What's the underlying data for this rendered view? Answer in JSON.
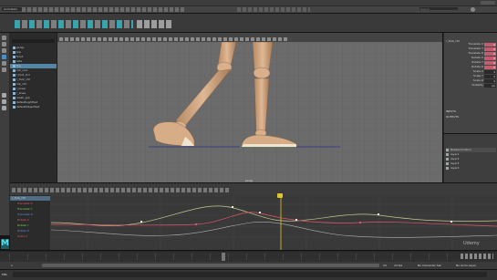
{
  "app": {
    "title": "Autodesk Maya",
    "logo_letter": "M",
    "accent": "#35b8c6",
    "viewport_bg": "#6b6b6b",
    "panel_bg": "#444444"
  },
  "menubar": {
    "items": [
      "File",
      "Edit",
      "Create",
      "Select",
      "Modify",
      "Display",
      "Windows",
      "Key",
      "Playback",
      "Audio",
      "Visualize",
      "Deform",
      "Constrain",
      "Control",
      "Cache",
      "Arnold",
      "Help"
    ]
  },
  "status_line": {
    "workspace": "Animation",
    "search_placeholder": "Search..."
  },
  "shelf": {
    "tabs": [
      "Curves / Surfaces",
      "Poly Modeling",
      "Sculpting",
      "Rigging",
      "Animation",
      "Rendering",
      "FX",
      "FX Caching",
      "Custom",
      "XGen"
    ]
  },
  "viewport": {
    "menu": [
      "View",
      "Shading",
      "Lighting",
      "Show",
      "Renderer",
      "Panels"
    ],
    "camera_label": "persp",
    "character": "wooden mannequin legs"
  },
  "outliner": {
    "menu": [
      "Display",
      "Show",
      "Help"
    ],
    "items": [
      {
        "name": "persp",
        "selected": false
      },
      {
        "name": "top",
        "selected": false
      },
      {
        "name": "front",
        "selected": false
      },
      {
        "name": "side",
        "selected": false
      },
      {
        "name": "Rig",
        "selected": true
      },
      {
        "name": "ctrl_root",
        "selected": false
      },
      {
        "name": "l_foot_ctrl",
        "selected": false
      },
      {
        "name": "r_foot_ctrl",
        "selected": false
      },
      {
        "name": "hip_ctrl",
        "selected": false
      },
      {
        "name": "l_knee",
        "selected": false
      },
      {
        "name": "r_knee",
        "selected": false
      },
      {
        "name": "mesh_grp",
        "selected": false
      },
      {
        "name": "defaultLightSet",
        "selected": false
      },
      {
        "name": "defaultObjectSet",
        "selected": false
      }
    ]
  },
  "channel_box": {
    "tabs": [
      "Channels",
      "Edit",
      "Object",
      "Show"
    ],
    "object": "r_foot_ctrl",
    "channels": [
      {
        "name": "Translate X",
        "value": "0"
      },
      {
        "name": "Translate Y",
        "value": "0"
      },
      {
        "name": "Translate Z",
        "value": "0"
      },
      {
        "name": "Rotate X",
        "value": "0"
      },
      {
        "name": "Rotate Y",
        "value": "0"
      },
      {
        "name": "Rotate Z",
        "value": "0"
      },
      {
        "name": "Scale X",
        "value": "1"
      },
      {
        "name": "Scale Y",
        "value": "1"
      },
      {
        "name": "Scale Z",
        "value": "1"
      },
      {
        "name": "Visibility",
        "value": "on"
      }
    ],
    "inputs_label": "INPUTS",
    "outputs_label": "OUTPUTS"
  },
  "layer_editor": {
    "tabs": [
      "Display",
      "Anim"
    ],
    "menu": [
      "Layers",
      "Options",
      "Help"
    ],
    "layers": [
      "BaseAnimation",
      "layer1",
      "layer2",
      "layer3",
      "layer4"
    ]
  },
  "graph_editor": {
    "menu": [
      "Edit",
      "View",
      "Select",
      "Curves",
      "Keys",
      "Tangents",
      "List",
      "Show",
      "Help"
    ],
    "outliner_items": [
      {
        "name": "r_foot_ctrl",
        "color": "#d8d8d8"
      },
      {
        "name": "Translate X",
        "color": "#e2566c"
      },
      {
        "name": "Translate Y",
        "color": "#7fd35b"
      },
      {
        "name": "Translate Z",
        "color": "#5b8fe2"
      },
      {
        "name": "Rotate X",
        "color": "#e2566c"
      },
      {
        "name": "Rotate Y",
        "color": "#7fd35b"
      },
      {
        "name": "Rotate Z",
        "color": "#5b8fe2"
      },
      {
        "name": "Scale X",
        "color": "#e2566c"
      }
    ],
    "current_frame_marker": "13"
  },
  "playback": {
    "start": "1",
    "end": "24",
    "fps": "24 fps",
    "character_set": "No Character Set",
    "anim_layer": "No Anim Layer"
  },
  "command_line": {
    "label": "MEL"
  },
  "watermark": "Udemy"
}
